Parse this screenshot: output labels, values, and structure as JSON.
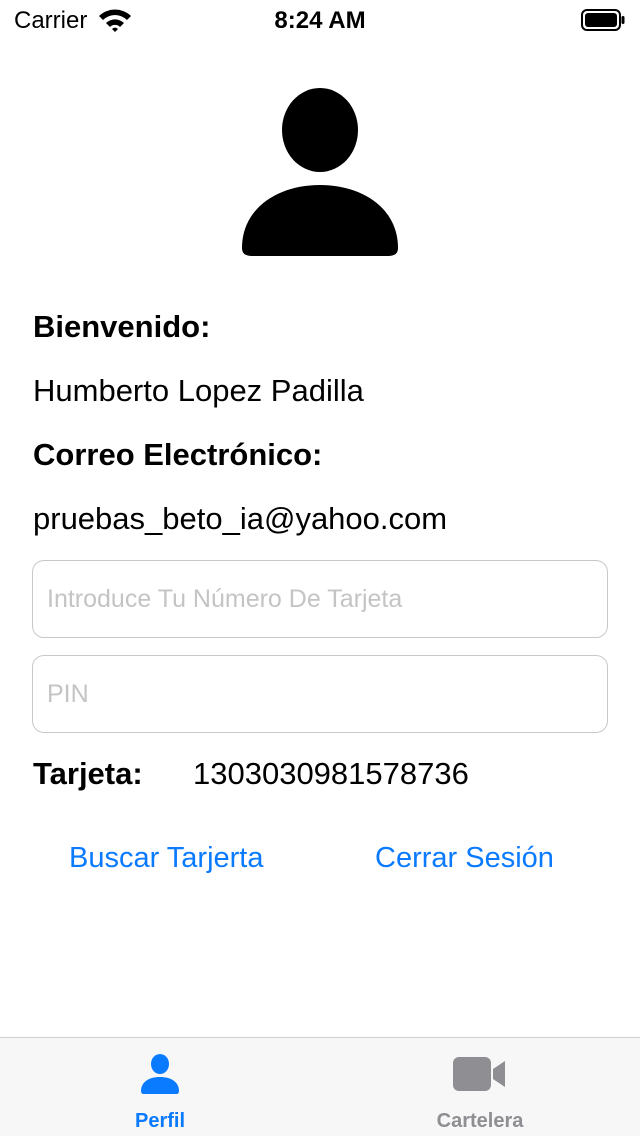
{
  "status_bar": {
    "carrier": "Carrier",
    "time": "8:24 AM"
  },
  "profile": {
    "avatar_icon": "person-icon",
    "welcome_label": "Bienvenido:",
    "user_name": "Humberto Lopez Padilla",
    "email_label": "Correo Electrónico:",
    "email_value": "pruebas_beto_ia@yahoo.com"
  },
  "form": {
    "card_number_placeholder": "Introduce Tu Número De Tarjeta",
    "card_number_value": "",
    "pin_placeholder": "PIN",
    "pin_value": ""
  },
  "card": {
    "label": "Tarjeta:",
    "number": "1303030981578736"
  },
  "actions": {
    "search_card_label": "Buscar Tarjerta",
    "logout_label": "Cerrar Sesión"
  },
  "tab_bar": {
    "tabs": [
      {
        "label": "Perfil",
        "icon": "person-icon",
        "selected": true
      },
      {
        "label": "Cartelera",
        "icon": "video-camera-icon",
        "selected": false
      }
    ]
  },
  "colors": {
    "accent": "#0a7aff",
    "tab_inactive": "#8e8e93",
    "placeholder": "#c4c4c6"
  }
}
